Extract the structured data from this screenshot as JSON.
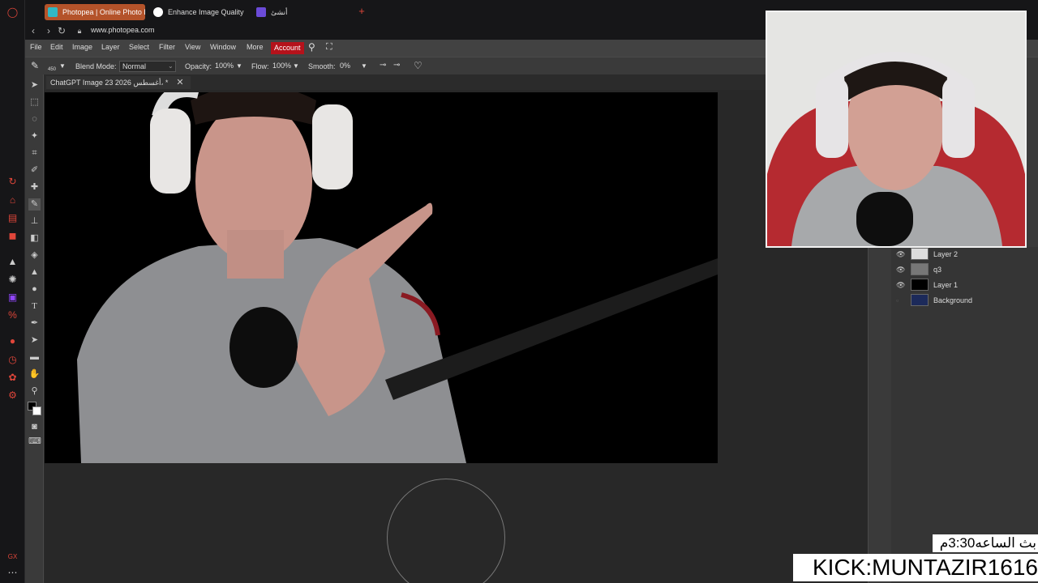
{
  "browser": {
    "tabs": [
      {
        "label": "Photopea | Online Photo Ed",
        "color": "#2fb8c4"
      },
      {
        "label": "Enhance Image Quality",
        "color": "#ffffff"
      },
      {
        "label": "أنشئ",
        "color": "#6b4bd8"
      }
    ],
    "url": "www.photopea.com"
  },
  "photopea": {
    "menu": [
      "File",
      "Edit",
      "Image",
      "Layer",
      "Select",
      "Filter",
      "View",
      "Window",
      "More"
    ],
    "account_label": "Account",
    "options": {
      "blend_label": "Blend Mode:",
      "blend_value": "Normal",
      "opacity_label": "Opacity:",
      "opacity_value": "100%",
      "flow_label": "Flow:",
      "flow_value": "100%",
      "smooth_label": "Smooth:",
      "smooth_value": "0%",
      "brush_size": "450"
    },
    "document_tab": "ChatGPT Image 23 أغسطس 2026، *",
    "layers": [
      {
        "name": "Layer 2",
        "visible": true
      },
      {
        "name": "q3",
        "visible": true
      },
      {
        "name": "Layer 1",
        "visible": true
      },
      {
        "name": "Background",
        "visible": false
      }
    ]
  },
  "stream_overlay": {
    "time_text": "بث الساعه3:30م",
    "kick_text": "KICK:MUNTAZIR1616"
  },
  "colors": {
    "account_red": "#b5121b",
    "active_tab": "#b4532a",
    "gx_accent": "#e0463a"
  }
}
